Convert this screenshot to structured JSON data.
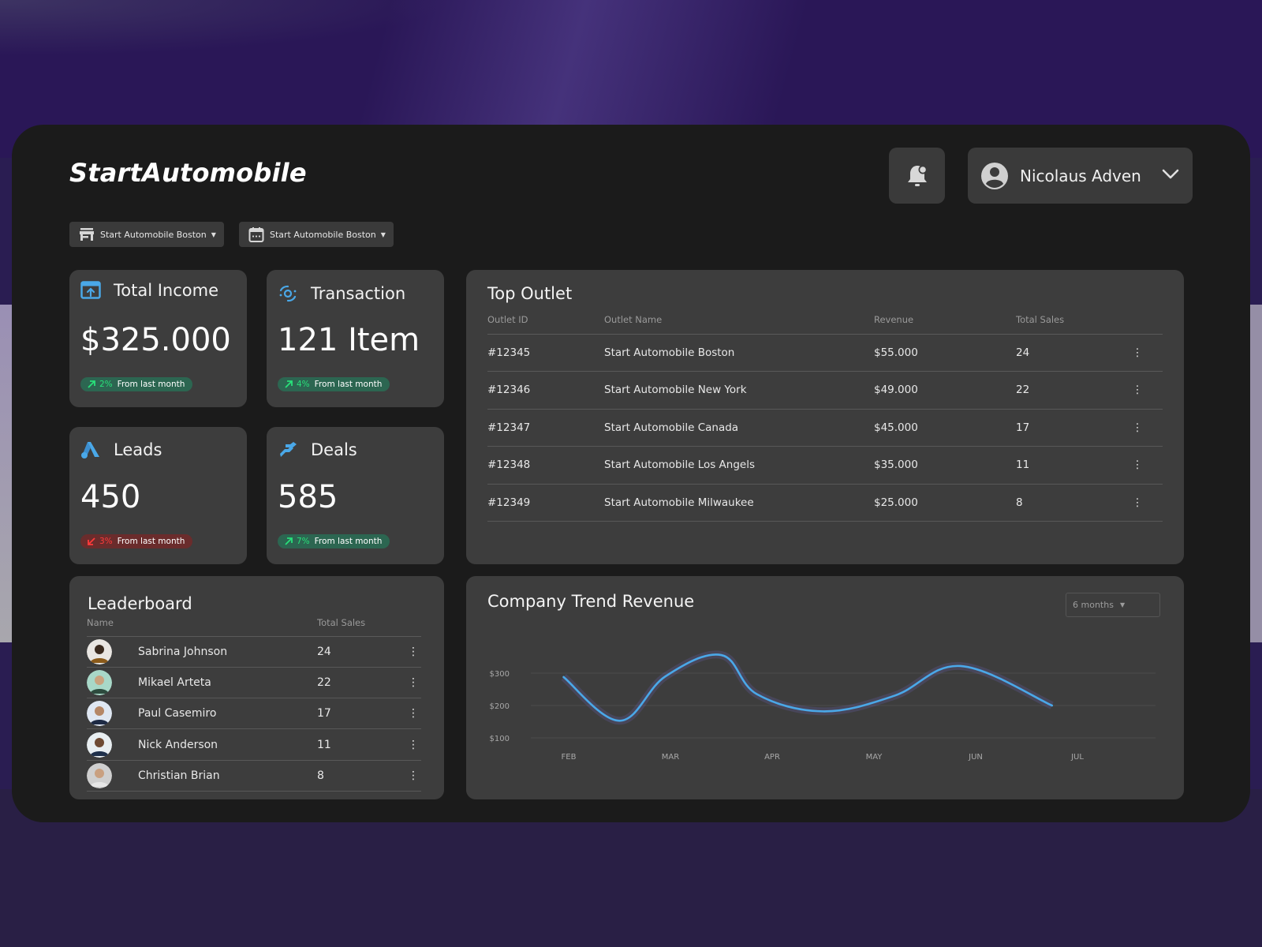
{
  "app": {
    "title": "StartAutomobile"
  },
  "header": {
    "user_name": "Nicolaus Adven",
    "notification_icon": "bell-icon",
    "user_icon": "user-circle-icon",
    "menu_icon": "chevron-down-icon"
  },
  "filters": [
    {
      "icon": "store-icon",
      "label": "Start Automobile Boston"
    },
    {
      "icon": "calendar-icon",
      "label": "Start Automobile Boston"
    }
  ],
  "stats": [
    {
      "icon": "income-icon",
      "title": "Total Income",
      "value": "$325.000",
      "change": "2%",
      "direction": "up",
      "note": "From last month"
    },
    {
      "icon": "transaction-icon",
      "title": "Transaction",
      "value": "121 Item",
      "change": "4%",
      "direction": "up",
      "note": "From last month"
    },
    {
      "icon": "leads-icon",
      "title": "Leads",
      "value": "450",
      "change": "3%",
      "direction": "down",
      "note": "From last month"
    },
    {
      "icon": "deals-icon",
      "title": "Deals",
      "value": "585",
      "change": "7%",
      "direction": "up",
      "note": "From last month"
    }
  ],
  "top_outlet": {
    "title": "Top Outlet",
    "columns": [
      "Outlet ID",
      "Outlet Name",
      "Revenue",
      "Total Sales"
    ],
    "rows": [
      {
        "id": "#12345",
        "name": "Start Automobile Boston",
        "revenue": "$55.000",
        "sales": "24"
      },
      {
        "id": "#12346",
        "name": "Start Automobile New York",
        "revenue": "$49.000",
        "sales": "22"
      },
      {
        "id": "#12347",
        "name": "Start Automobile Canada",
        "revenue": "$45.000",
        "sales": "17"
      },
      {
        "id": "#12348",
        "name": "Start Automobile Los Angels",
        "revenue": "$35.000",
        "sales": "11"
      },
      {
        "id": "#12349",
        "name": "Start Automobile Milwaukee",
        "revenue": "$25.000",
        "sales": "8"
      }
    ]
  },
  "leaderboard": {
    "title": "Leaderboard",
    "columns": [
      "Name",
      "Total Sales"
    ],
    "rows": [
      {
        "name": "Sabrina Johnson",
        "sales": "24"
      },
      {
        "name": "Mikael Arteta",
        "sales": "22"
      },
      {
        "name": "Paul Casemiro",
        "sales": "17"
      },
      {
        "name": "Nick Anderson",
        "sales": "11"
      },
      {
        "name": "Christian Brian",
        "sales": "8"
      }
    ]
  },
  "trend": {
    "title": "Company Trend Revenue",
    "range_selected": "6 months"
  },
  "colors": {
    "accent_blue": "#4aa8e8",
    "up_green": "#29e07a",
    "down_red": "#ff3b3b",
    "card": "#3d3d3d",
    "frame": "#1b1b1b"
  },
  "chart_data": {
    "type": "line",
    "title": "Company Trend Revenue",
    "xlabel": "",
    "ylabel": "",
    "categories": [
      "FEB",
      "MAR",
      "APR",
      "MAY",
      "JUN",
      "JUL"
    ],
    "y_ticks": [
      "$100",
      "$200",
      "$300"
    ],
    "ylim": [
      100,
      300
    ],
    "grid": true,
    "smooth": true,
    "series": [
      {
        "name": "Revenue",
        "x": [
          0.45,
          1.0,
          1.45,
          2.0,
          2.35,
          3.0,
          3.7,
          4.35,
          5.25
        ],
        "values": [
          288,
          153,
          290,
          356,
          235,
          182,
          230,
          322,
          200
        ]
      }
    ],
    "x_positions_note": "x values are fractional month indices (FEB=0.5 ... JUL=5.5 centered on labels)"
  }
}
